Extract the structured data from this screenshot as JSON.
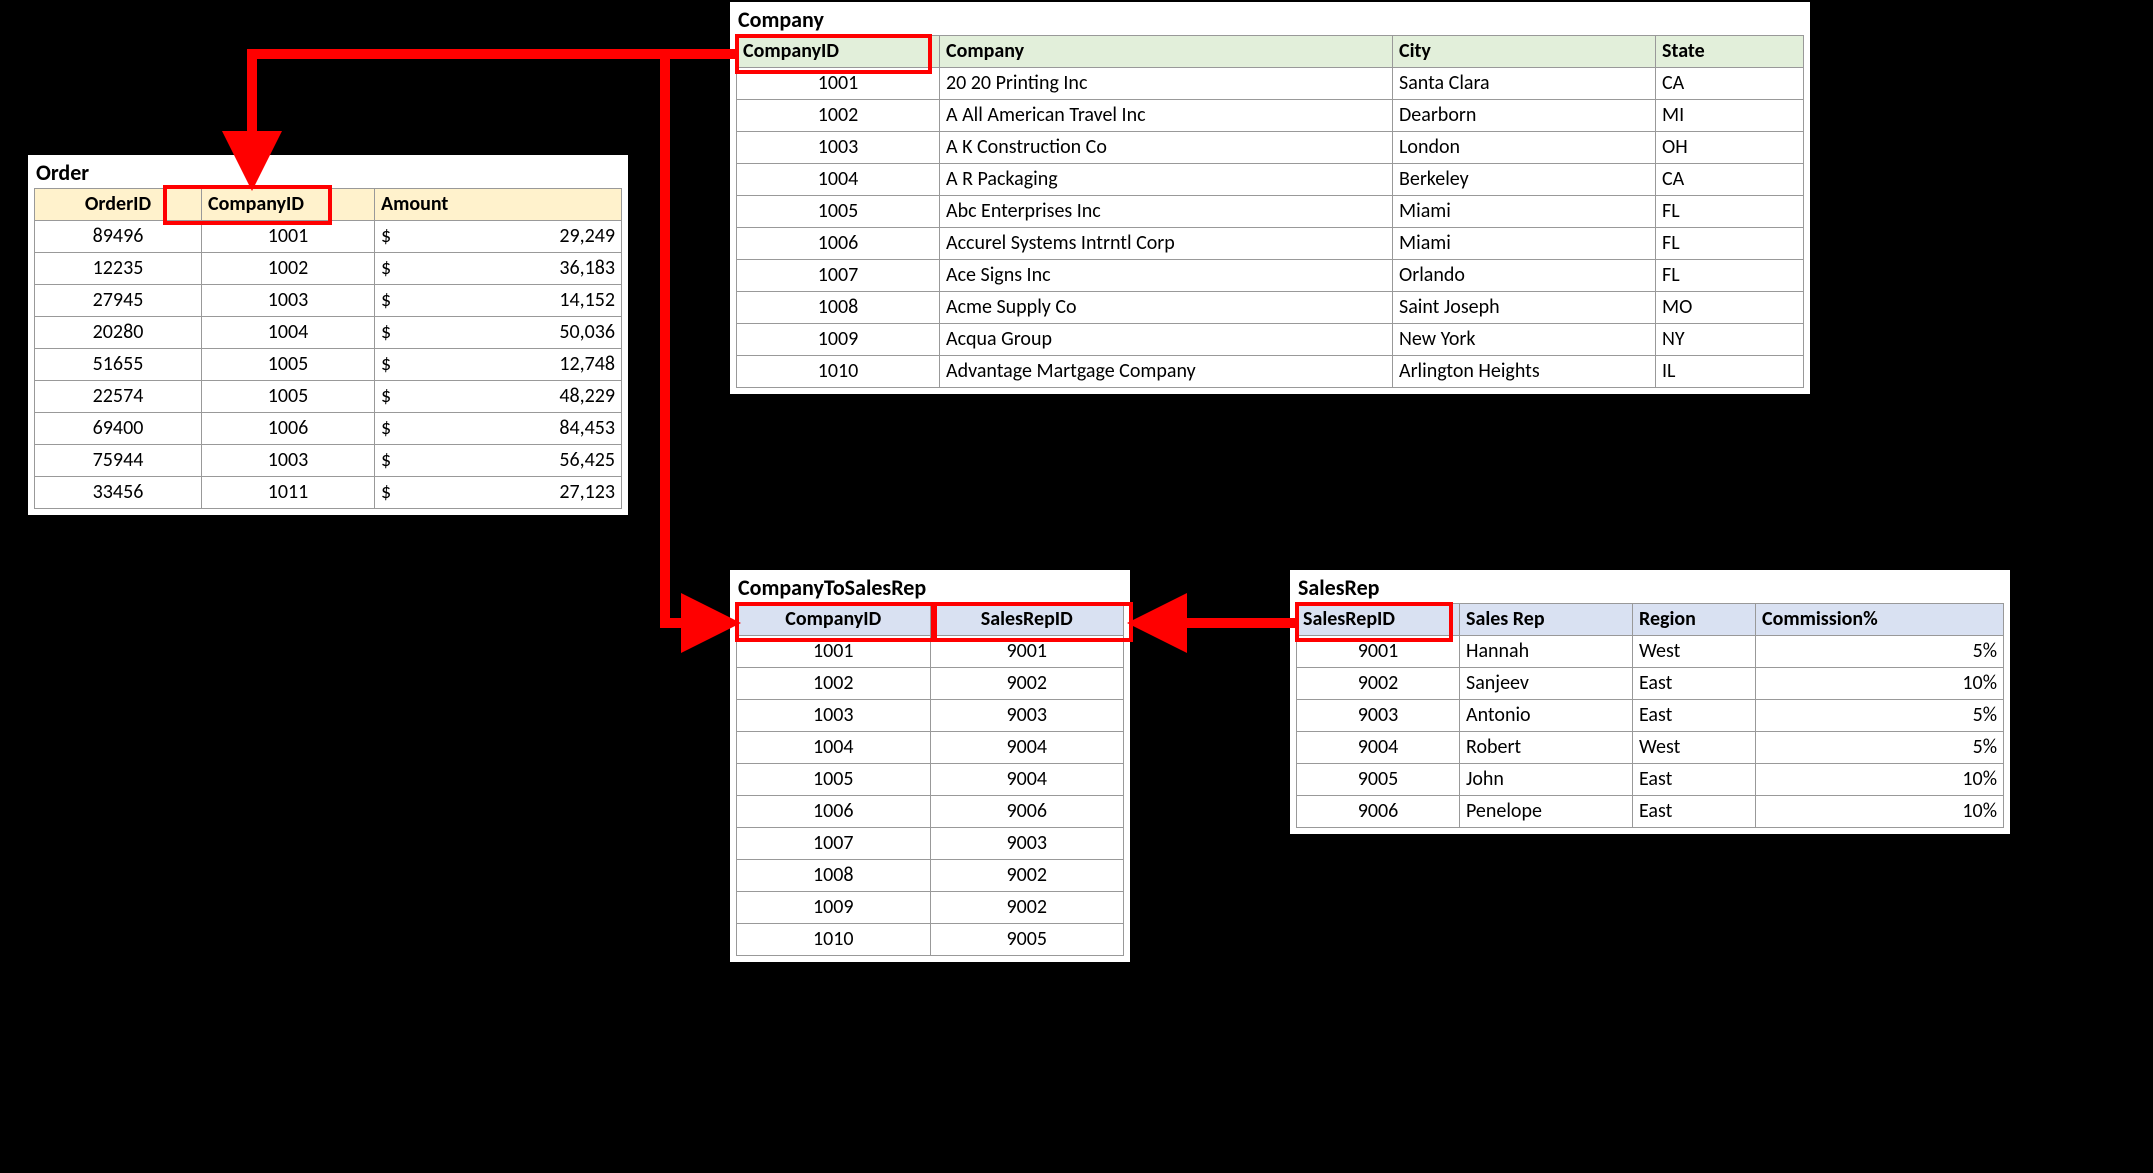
{
  "order": {
    "title": "Order",
    "headers": {
      "id": "OrderID",
      "company": "CompanyID",
      "amount": "Amount"
    },
    "rows": [
      {
        "id": "89496",
        "company": "1001",
        "amount": "29,249"
      },
      {
        "id": "12235",
        "company": "1002",
        "amount": "36,183"
      },
      {
        "id": "27945",
        "company": "1003",
        "amount": "14,152"
      },
      {
        "id": "20280",
        "company": "1004",
        "amount": "50,036"
      },
      {
        "id": "51655",
        "company": "1005",
        "amount": "12,748"
      },
      {
        "id": "22574",
        "company": "1005",
        "amount": "48,229"
      },
      {
        "id": "69400",
        "company": "1006",
        "amount": "84,453"
      },
      {
        "id": "75944",
        "company": "1003",
        "amount": "56,425"
      },
      {
        "id": "33456",
        "company": "1011",
        "amount": "27,123"
      }
    ],
    "currency": "$"
  },
  "company": {
    "title": "Company",
    "headers": {
      "id": "CompanyID",
      "name": "Company",
      "city": "City",
      "state": "State"
    },
    "rows": [
      {
        "id": "1001",
        "name": "20 20 Printing Inc",
        "city": "Santa Clara",
        "state": "CA"
      },
      {
        "id": "1002",
        "name": "A All American Travel Inc",
        "city": "Dearborn",
        "state": "MI"
      },
      {
        "id": "1003",
        "name": "A K Construction Co",
        "city": "London",
        "state": "OH"
      },
      {
        "id": "1004",
        "name": "A R Packaging",
        "city": "Berkeley",
        "state": "CA"
      },
      {
        "id": "1005",
        "name": "Abc Enterprises Inc",
        "city": "Miami",
        "state": "FL"
      },
      {
        "id": "1006",
        "name": "Accurel Systems Intrntl Corp",
        "city": "Miami",
        "state": "FL"
      },
      {
        "id": "1007",
        "name": "Ace Signs Inc",
        "city": "Orlando",
        "state": "FL"
      },
      {
        "id": "1008",
        "name": "Acme Supply Co",
        "city": "Saint Joseph",
        "state": "MO"
      },
      {
        "id": "1009",
        "name": "Acqua Group",
        "city": "New York",
        "state": "NY"
      },
      {
        "id": "1010",
        "name": "Advantage Martgage Company",
        "city": "Arlington Heights",
        "state": "IL"
      }
    ]
  },
  "c2s": {
    "title": "CompanyToSalesRep",
    "headers": {
      "company": "CompanyID",
      "rep": "SalesRepID"
    },
    "rows": [
      {
        "company": "1001",
        "rep": "9001"
      },
      {
        "company": "1002",
        "rep": "9002"
      },
      {
        "company": "1003",
        "rep": "9003"
      },
      {
        "company": "1004",
        "rep": "9004"
      },
      {
        "company": "1005",
        "rep": "9004"
      },
      {
        "company": "1006",
        "rep": "9006"
      },
      {
        "company": "1007",
        "rep": "9003"
      },
      {
        "company": "1008",
        "rep": "9002"
      },
      {
        "company": "1009",
        "rep": "9002"
      },
      {
        "company": "1010",
        "rep": "9005"
      }
    ]
  },
  "salesrep": {
    "title": "SalesRep",
    "headers": {
      "id": "SalesRepID",
      "name": "Sales Rep",
      "region": "Region",
      "comm": "Commission%"
    },
    "rows": [
      {
        "id": "9001",
        "name": "Hannah",
        "region": "West",
        "comm": "5%"
      },
      {
        "id": "9002",
        "name": "Sanjeev",
        "region": "East",
        "comm": "10%"
      },
      {
        "id": "9003",
        "name": "Antonio",
        "region": "East",
        "comm": "5%"
      },
      {
        "id": "9004",
        "name": "Robert",
        "region": "West",
        "comm": "5%"
      },
      {
        "id": "9005",
        "name": "John",
        "region": "East",
        "comm": "10%"
      },
      {
        "id": "9006",
        "name": "Penelope",
        "region": "East",
        "comm": "10%"
      }
    ]
  }
}
